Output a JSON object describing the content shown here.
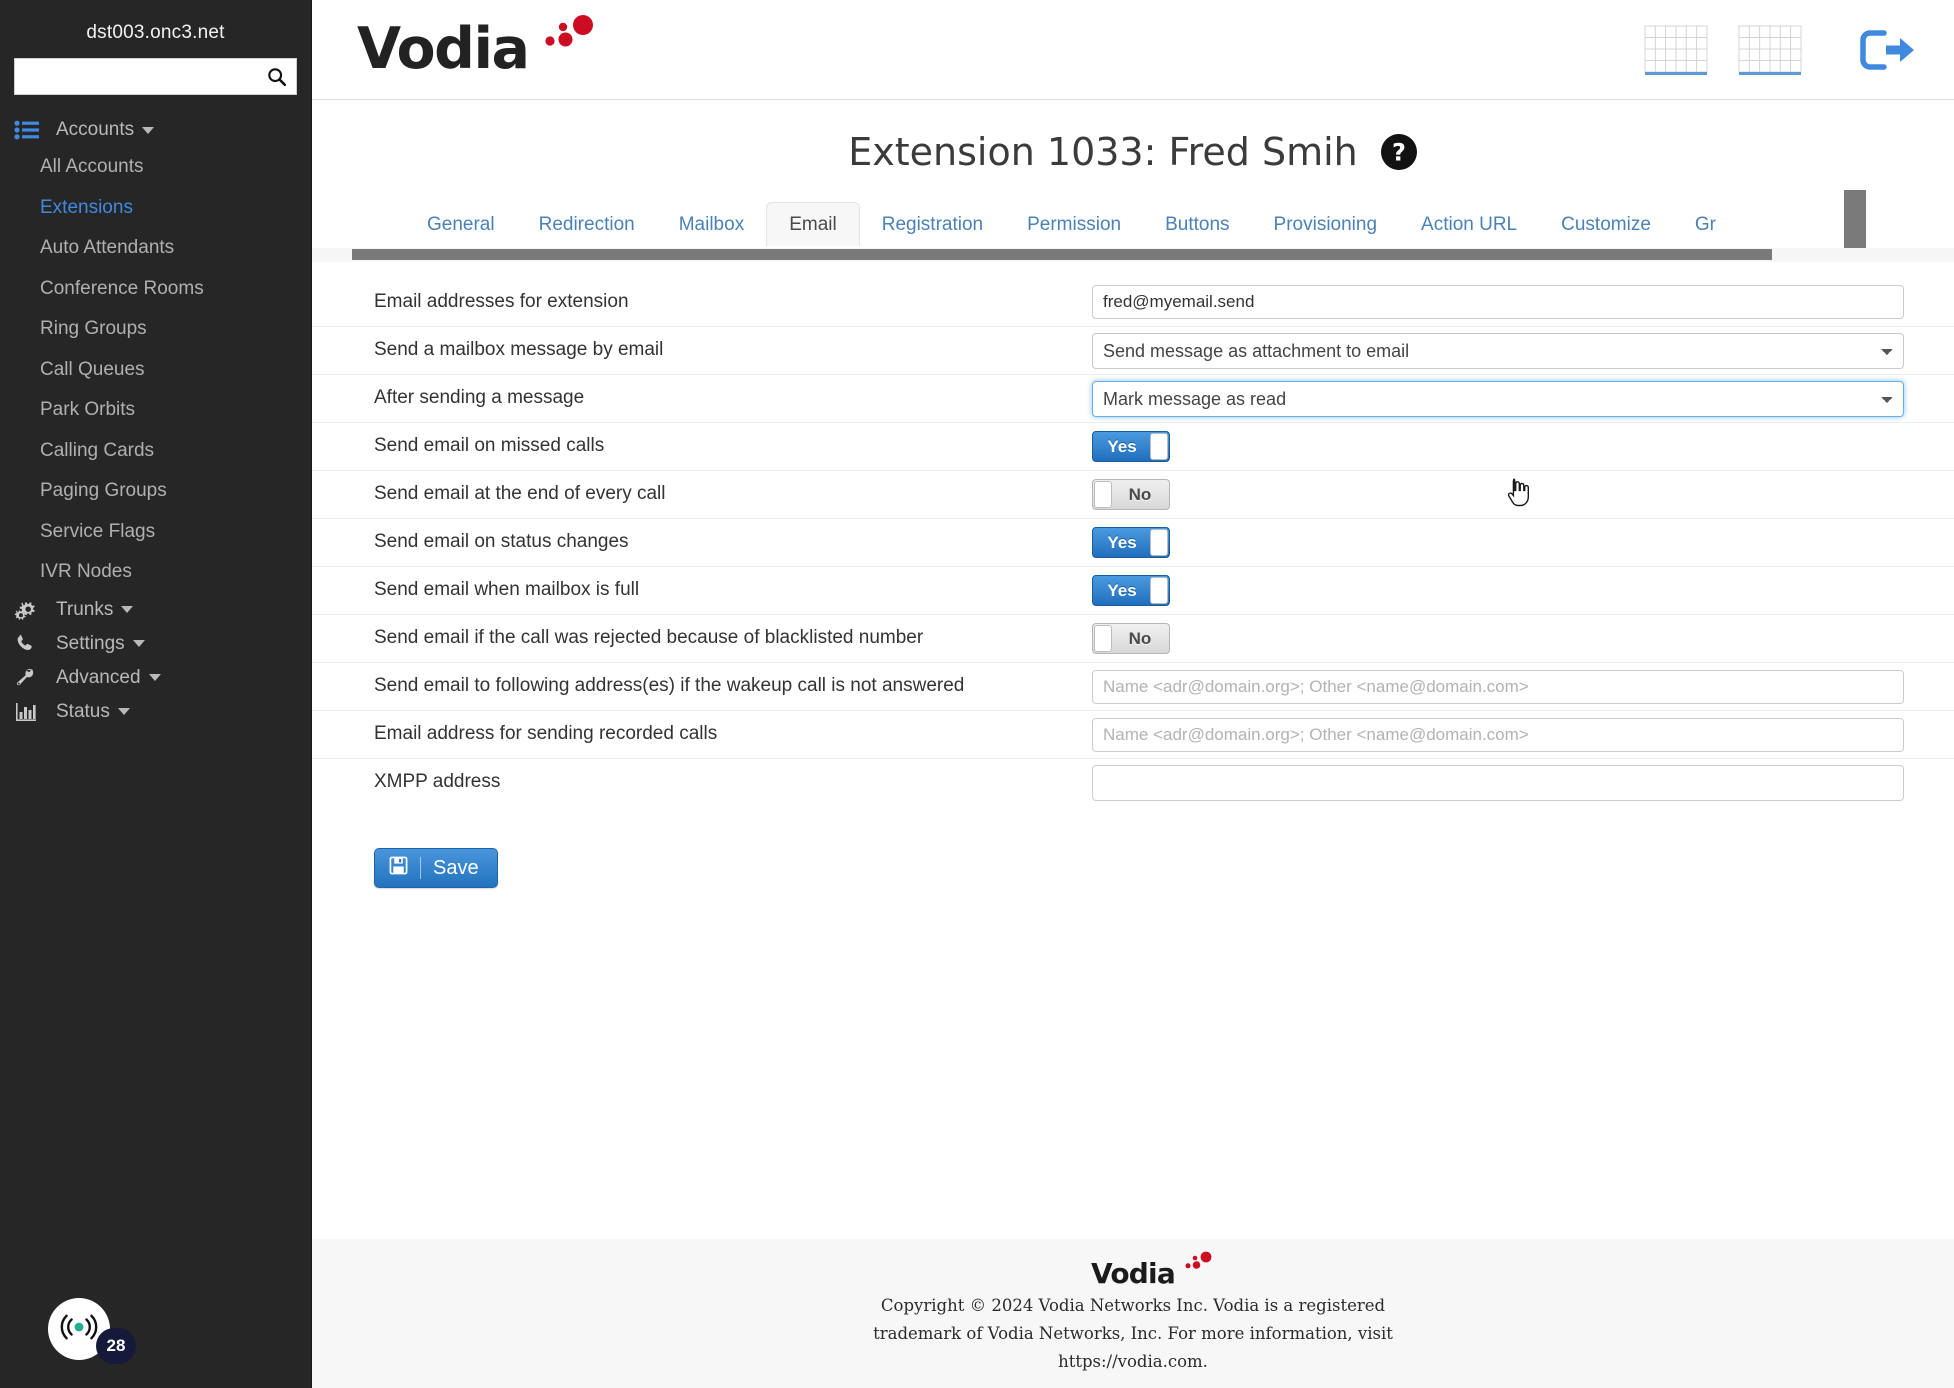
{
  "sidebar": {
    "host": "dst003.onc3.net",
    "search_placeholder": "",
    "search_value": "",
    "groups": [
      {
        "label": "Accounts",
        "icon": "list-icon",
        "items": [
          {
            "label": "All Accounts",
            "active": false
          },
          {
            "label": "Extensions",
            "active": true
          },
          {
            "label": "Auto Attendants",
            "active": false
          },
          {
            "label": "Conference Rooms",
            "active": false
          },
          {
            "label": "Ring Groups",
            "active": false
          },
          {
            "label": "Call Queues",
            "active": false
          },
          {
            "label": "Park Orbits",
            "active": false
          },
          {
            "label": "Calling Cards",
            "active": false
          },
          {
            "label": "Paging Groups",
            "active": false
          },
          {
            "label": "Service Flags",
            "active": false
          },
          {
            "label": "IVR Nodes",
            "active": false
          }
        ]
      },
      {
        "label": "Trunks",
        "icon": "gears-icon",
        "items": []
      },
      {
        "label": "Settings",
        "icon": "phone-icon",
        "items": []
      },
      {
        "label": "Advanced",
        "icon": "wrench-icon",
        "items": []
      },
      {
        "label": "Status",
        "icon": "bar-chart-icon",
        "items": []
      }
    ],
    "broadcast": {
      "icon": "broadcast-icon",
      "badge": "28"
    }
  },
  "header": {
    "logo_text": "Vodia",
    "icons": [
      {
        "name": "grid-icon-1"
      },
      {
        "name": "grid-icon-2"
      },
      {
        "name": "logout-icon"
      }
    ]
  },
  "page": {
    "title": "Extension 1033: Fred Smih",
    "help_icon": "help-circle-icon"
  },
  "tabs": [
    {
      "label": "General",
      "active": false
    },
    {
      "label": "Redirection",
      "active": false
    },
    {
      "label": "Mailbox",
      "active": false
    },
    {
      "label": "Email",
      "active": true
    },
    {
      "label": "Registration",
      "active": false
    },
    {
      "label": "Permission",
      "active": false
    },
    {
      "label": "Buttons",
      "active": false
    },
    {
      "label": "Provisioning",
      "active": false
    },
    {
      "label": "Action URL",
      "active": false
    },
    {
      "label": "Customize",
      "active": false
    },
    {
      "label": "Gra",
      "active": false
    }
  ],
  "form": {
    "rows": [
      {
        "label": "Email addresses for extension",
        "type": "text",
        "value": "fred@myemail.send",
        "placeholder": ""
      },
      {
        "label": "Send a mailbox message by email",
        "type": "select",
        "value": "Send message as attachment to email",
        "focused": false,
        "options": [
          "Send message as attachment to email"
        ]
      },
      {
        "label": "After sending a message",
        "type": "select",
        "value": "Mark message as read",
        "focused": true,
        "options": [
          "Mark message as read"
        ]
      },
      {
        "label": "Send email on missed calls",
        "type": "toggle",
        "value": "Yes",
        "on": true
      },
      {
        "label": "Send email at the end of every call",
        "type": "toggle",
        "value": "No",
        "on": false
      },
      {
        "label": "Send email on status changes",
        "type": "toggle",
        "value": "Yes",
        "on": true
      },
      {
        "label": "Send email when mailbox is full",
        "type": "toggle",
        "value": "Yes",
        "on": true
      },
      {
        "label": "Send email if the call was rejected because of blacklisted number",
        "type": "toggle",
        "value": "No",
        "on": false
      },
      {
        "label": "Send email to following address(es) if the wakeup call is not answered",
        "type": "text",
        "value": "",
        "placeholder": "Name <adr@domain.org>; Other <name@domain.com>"
      },
      {
        "label": "Email address for sending recorded calls",
        "type": "text",
        "value": "",
        "placeholder": "Name <adr@domain.org>; Other <name@domain.com>"
      },
      {
        "label": "XMPP address",
        "type": "text",
        "value": "",
        "placeholder": ""
      }
    ],
    "save_label": "Save",
    "save_icon": "floppy-disk-icon"
  },
  "footer": {
    "logo_text": "Vodia",
    "line1": "Copyright © 2024 Vodia Networks Inc. Vodia is a registered",
    "line2": "trademark of Vodia Networks, Inc. For more information, visit",
    "line3": "https://vodia.com."
  },
  "colors": {
    "accent_blue": "#3f8ae0",
    "tab_link": "#4a82b8",
    "sidebar_bg": "#262626",
    "brand_red": "#cc0c22",
    "toggle_on": "#2272bd",
    "badge_bg": "#15193a"
  }
}
